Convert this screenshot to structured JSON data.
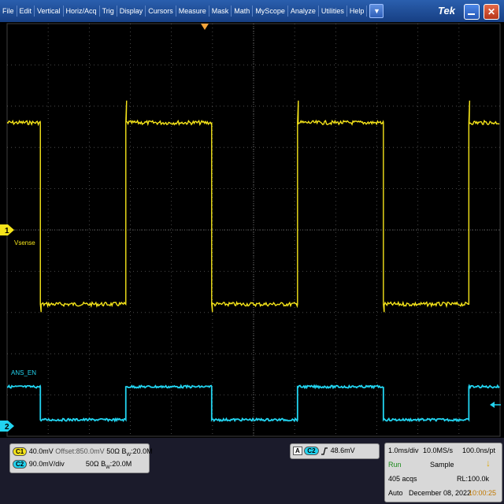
{
  "menu": {
    "items": [
      "File",
      "Edit",
      "Vertical",
      "Horiz/Acq",
      "Trig",
      "Display",
      "Cursors",
      "Measure",
      "Mask",
      "Math",
      "MyScope",
      "Analyze",
      "Utilities",
      "Help"
    ],
    "dropdown_icon": "chevron-down-icon",
    "brand": "Tek"
  },
  "display": {
    "ch1_marker": "1",
    "ch2_marker": "2",
    "ch1_label": "Vsense",
    "ch2_label": "ANS_EN",
    "colors": {
      "ch1": "#f5e41a",
      "ch2": "#22d4f0",
      "grid": "#5a5a5a",
      "trigger": "#f2a33a"
    }
  },
  "chart_data": {
    "type": "line",
    "series": [
      {
        "name": "Vsense",
        "levels_div": [
          2.6,
          -1.8
        ],
        "edges_div": [
          0.81,
          2.89,
          4.98,
          7.07,
          9.16,
          11.24
        ]
      },
      {
        "name": "ANS_EN",
        "levels_div": [
          -3.8,
          -4.6
        ],
        "edges_div": [
          0.81,
          2.89,
          4.98,
          7.07,
          9.16,
          11.24
        ]
      }
    ]
  },
  "channels": {
    "ch1": {
      "badge": "C1",
      "scale": "40.0mV",
      "offset": "Offset:850.0mV",
      "impedance": "50Ω",
      "bw_label": "B",
      "bw_sub": "W",
      "bw": ":20.0M"
    },
    "ch2": {
      "badge": "C2",
      "scale": "90.0mV/div",
      "impedance": "50Ω",
      "bw_label": "B",
      "bw_sub": "W",
      "bw": ":20.0M"
    }
  },
  "trigger": {
    "mode_badge": "A",
    "source_badge": "C2",
    "slope_icon": "rising-edge-icon",
    "level": "48.6mV"
  },
  "acquisition": {
    "timebase": "1.0ms/div",
    "sample_rate": "10.0MS/s",
    "resolution": "100.0ns/pt",
    "run_state": "Run",
    "mode": "Sample",
    "acqs": "405 acqs",
    "record_length": "RL:100.0k",
    "trigger_mode": "Auto",
    "date": "December 08, 2022",
    "time": "10:00:25"
  }
}
